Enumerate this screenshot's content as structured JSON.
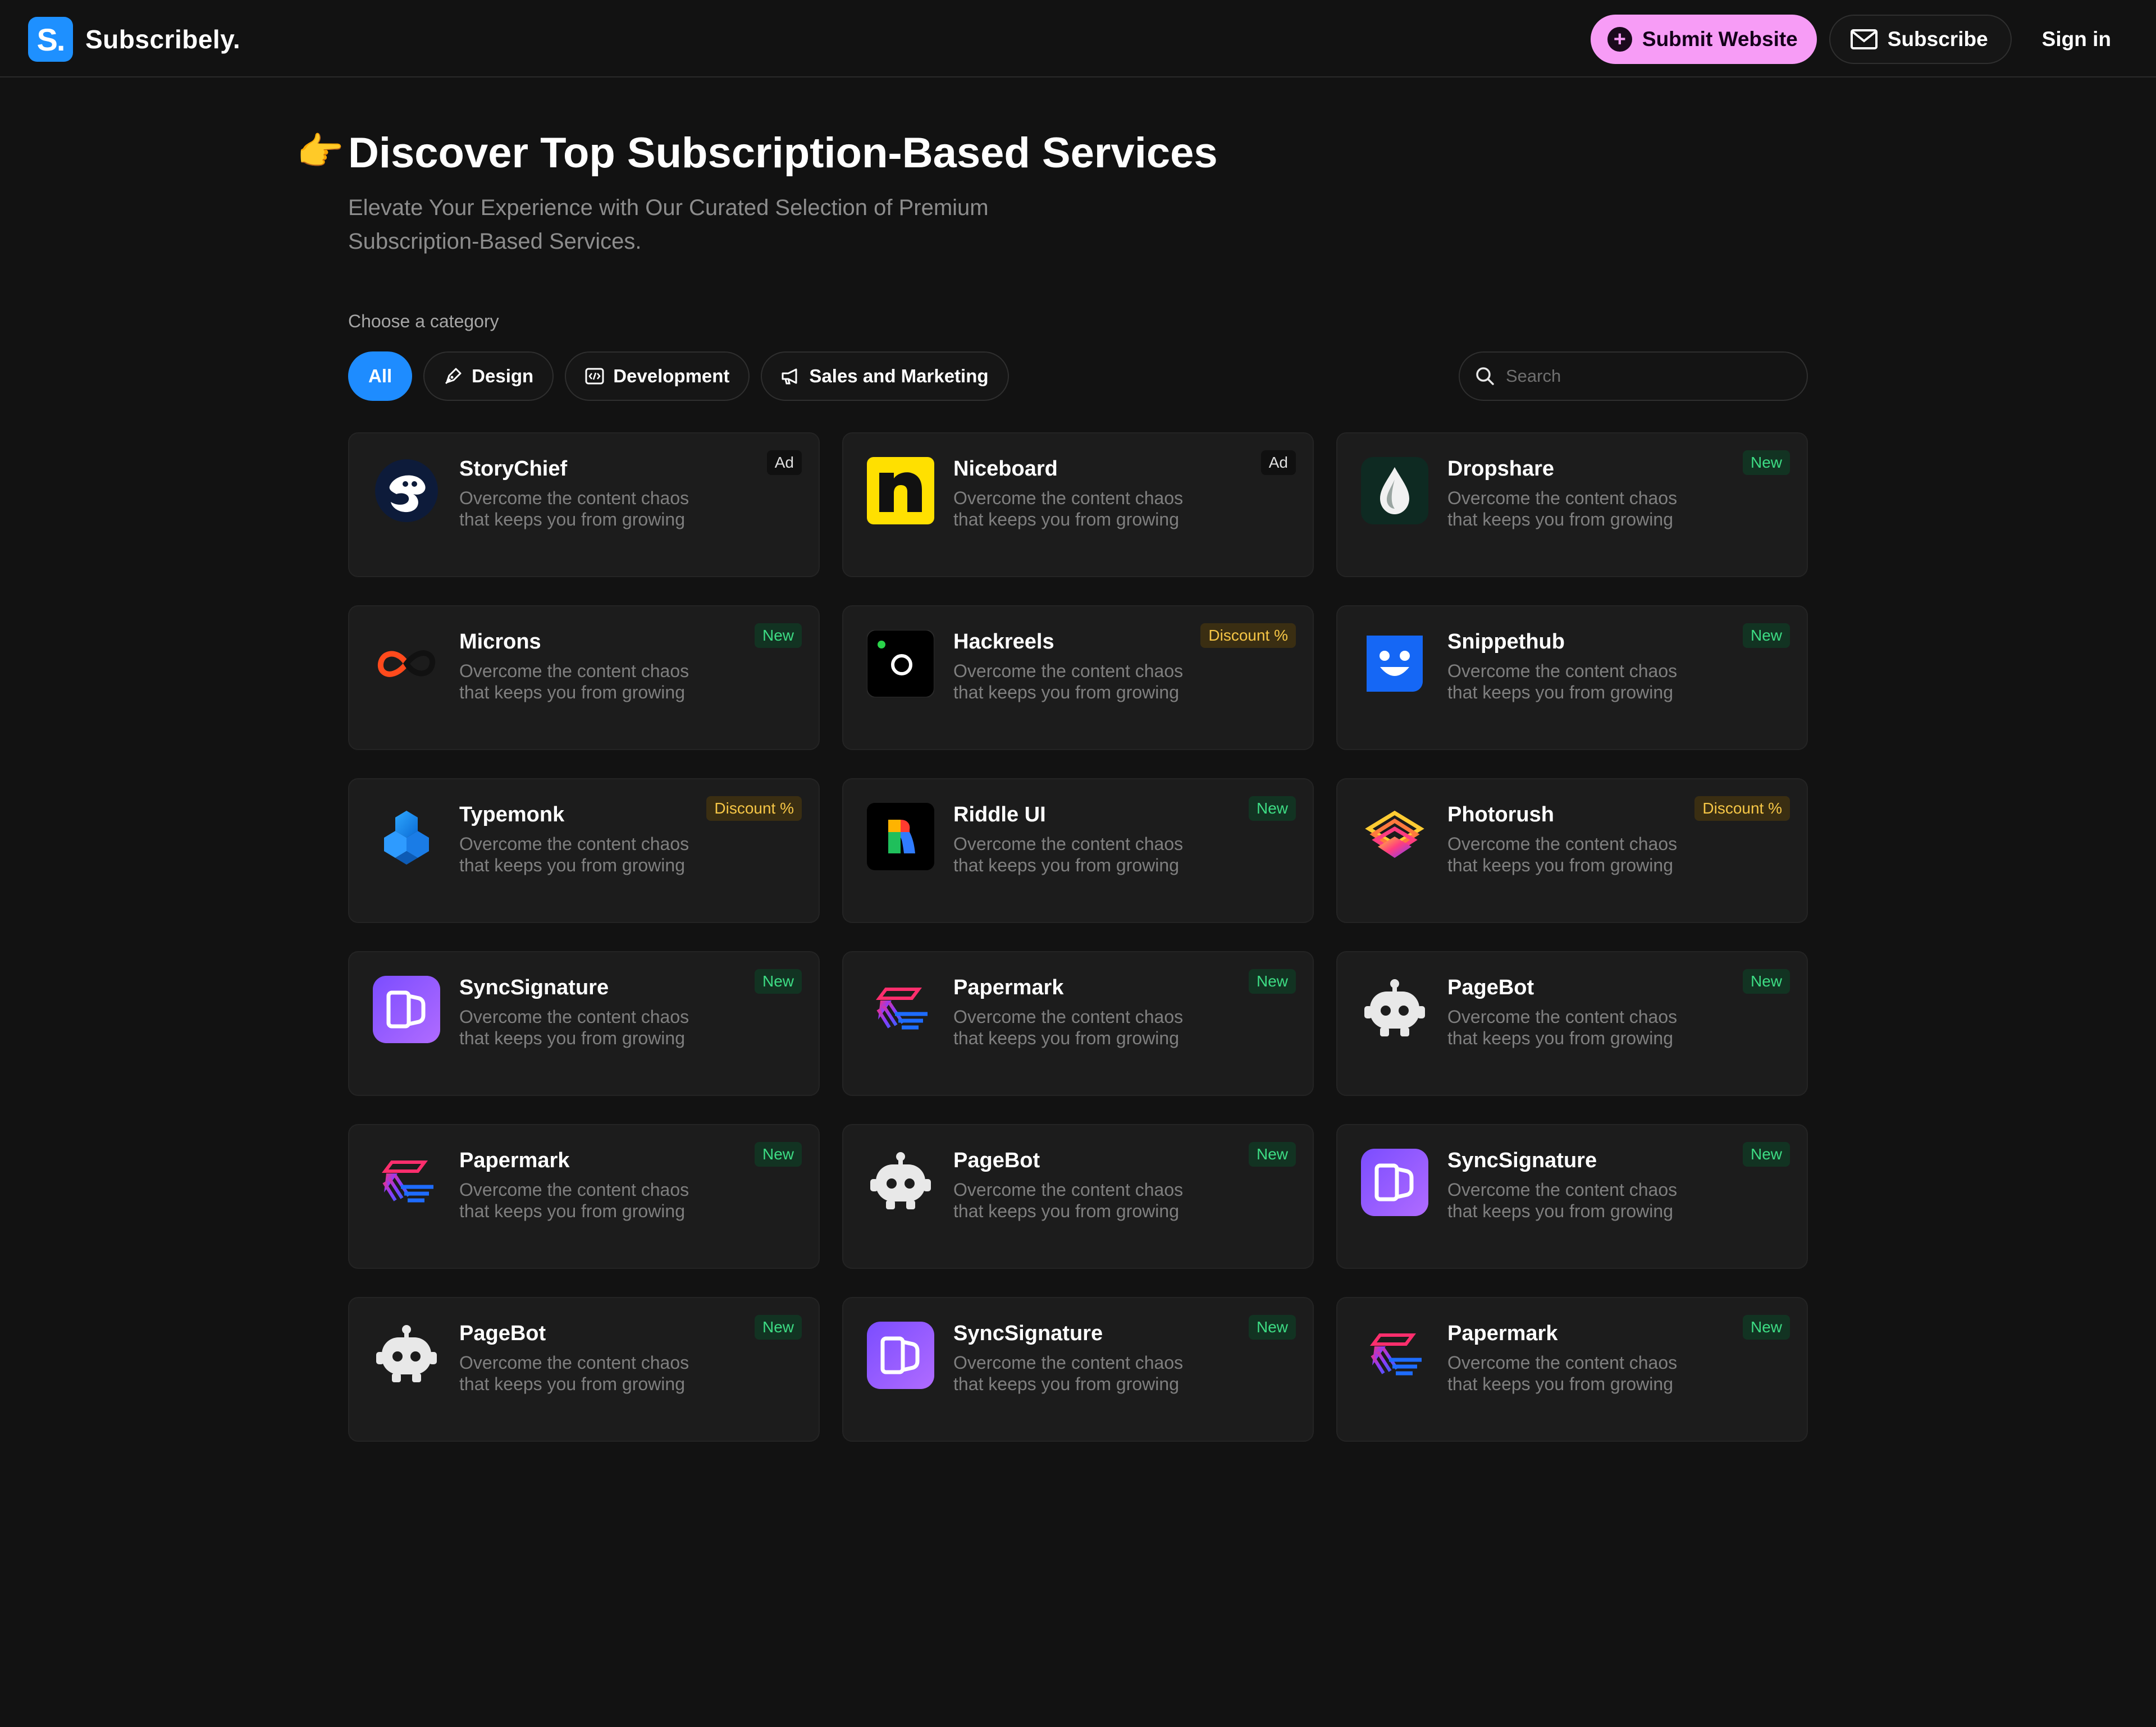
{
  "header": {
    "brand_letter": "S.",
    "brand_name": "Subscribely.",
    "submit_label": "Submit Website",
    "subscribe_label": "Subscribe",
    "signin_label": "Sign in",
    "accent_color": "#f79cf6",
    "brand_color": "#1e90ff"
  },
  "hero": {
    "emoji": "👉",
    "title": "Discover Top Subscription-Based Services",
    "subtitle": "Elevate Your Experience with Our Curated Selection of Premium Subscription-Based Services."
  },
  "category": {
    "label": "Choose a category",
    "chips": [
      {
        "label": "All",
        "active": true,
        "icon": ""
      },
      {
        "label": "Design",
        "active": false,
        "icon": "pen-tool-icon"
      },
      {
        "label": "Development",
        "active": false,
        "icon": "code-icon"
      },
      {
        "label": "Sales and Marketing",
        "active": false,
        "icon": "megaphone-icon"
      }
    ]
  },
  "search": {
    "placeholder": "Search"
  },
  "cards": [
    {
      "name": "StoryChief",
      "description": "Overcome the content chaos that keeps you from growing",
      "badge": "Ad",
      "badge_type": "ad",
      "logo": "storychief-logo-icon"
    },
    {
      "name": "Niceboard",
      "description": "Overcome the content chaos that keeps you from growing",
      "badge": "Ad",
      "badge_type": "ad",
      "logo": "niceboard-logo-icon"
    },
    {
      "name": "Dropshare",
      "description": "Overcome the content chaos that keeps you from growing",
      "badge": "New",
      "badge_type": "new",
      "logo": "dropshare-logo-icon"
    },
    {
      "name": "Microns",
      "description": "Overcome the content chaos that keeps you from growing",
      "badge": "New",
      "badge_type": "new",
      "logo": "microns-logo-icon"
    },
    {
      "name": "Hackreels",
      "description": "Overcome the content chaos that keeps you from growing",
      "badge": "Discount %",
      "badge_type": "discount",
      "logo": "hackreels-logo-icon"
    },
    {
      "name": "Snippethub",
      "description": "Overcome the content chaos that keeps you from growing",
      "badge": "New",
      "badge_type": "new",
      "logo": "snippethub-logo-icon"
    },
    {
      "name": "Typemonk",
      "description": "Overcome the content chaos that keeps you from growing",
      "badge": "Discount %",
      "badge_type": "discount",
      "logo": "typemonk-logo-icon"
    },
    {
      "name": "Riddle UI",
      "description": "Overcome the content chaos that keeps you from growing",
      "badge": "New",
      "badge_type": "new",
      "logo": "riddle-ui-logo-icon"
    },
    {
      "name": "Photorush",
      "description": "Overcome the content chaos that keeps you from growing",
      "badge": "Discount %",
      "badge_type": "discount",
      "logo": "photorush-logo-icon"
    },
    {
      "name": "SyncSignature",
      "description": "Overcome the content chaos that keeps you from growing",
      "badge": "New",
      "badge_type": "new",
      "logo": "syncsignature-logo-icon"
    },
    {
      "name": "Papermark",
      "description": "Overcome the content chaos that keeps you from growing",
      "badge": "New",
      "badge_type": "new",
      "logo": "papermark-logo-icon"
    },
    {
      "name": "PageBot",
      "description": "Overcome the content chaos that keeps you from growing",
      "badge": "New",
      "badge_type": "new",
      "logo": "pagebot-logo-icon"
    },
    {
      "name": "Papermark",
      "description": "Overcome the content chaos that keeps you from growing",
      "badge": "New",
      "badge_type": "new",
      "logo": "papermark-logo-icon"
    },
    {
      "name": "PageBot",
      "description": "Overcome the content chaos that keeps you from growing",
      "badge": "New",
      "badge_type": "new",
      "logo": "pagebot-logo-icon"
    },
    {
      "name": "SyncSignature",
      "description": "Overcome the content chaos that keeps you from growing",
      "badge": "New",
      "badge_type": "new",
      "logo": "syncsignature-logo-icon"
    },
    {
      "name": "PageBot",
      "description": "Overcome the content chaos that keeps you from growing",
      "badge": "New",
      "badge_type": "new",
      "logo": "pagebot-logo-icon"
    },
    {
      "name": "SyncSignature",
      "description": "Overcome the content chaos that keeps you from growing",
      "badge": "New",
      "badge_type": "new",
      "logo": "syncsignature-logo-icon"
    },
    {
      "name": "Papermark",
      "description": "Overcome the content chaos that keeps you from growing",
      "badge": "New",
      "badge_type": "new",
      "logo": "papermark-logo-icon"
    }
  ]
}
